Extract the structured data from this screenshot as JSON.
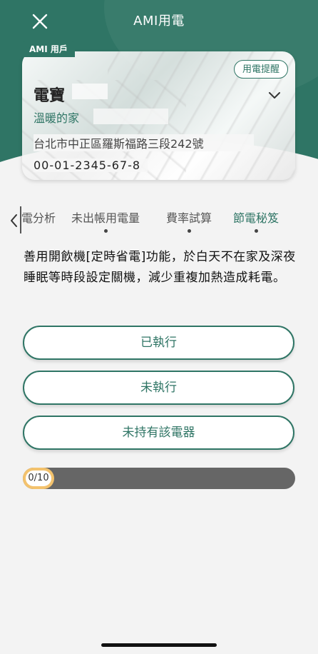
{
  "header": {
    "title": "AMI用電",
    "close_icon": "close-icon"
  },
  "account_card": {
    "tag": "AMI 用戶",
    "remind_button": "用電提醒",
    "name": "電寶",
    "home_name": "溫暖的家",
    "address": "台北市中正區羅斯福路三段242號",
    "account_number": "00-01-2345-67-8",
    "chevron_icon": "chevron-down-icon"
  },
  "tabs": {
    "back_icon": "chevron-left-icon",
    "items": [
      {
        "label": "電分析",
        "has_dot": false
      },
      {
        "label": "未出帳用電量",
        "has_dot": true
      },
      {
        "label": "費率試算",
        "has_dot": true
      },
      {
        "label": "節電秘笈",
        "has_dot": true,
        "active": true
      }
    ]
  },
  "tip": {
    "text": "善用開飲機[定時省電]功能，於白天不在家及深夜睡眠等時段設定關機，減少重複加熱造成耗電。"
  },
  "options": [
    {
      "label": "已執行"
    },
    {
      "label": "未執行"
    },
    {
      "label": "未持有該電器"
    }
  ],
  "progress": {
    "label": "0/10",
    "current": 0,
    "total": 10
  },
  "colors": {
    "brand": "#2f7565",
    "progress_accent": "#f3c26d",
    "progress_track": "#666666"
  }
}
